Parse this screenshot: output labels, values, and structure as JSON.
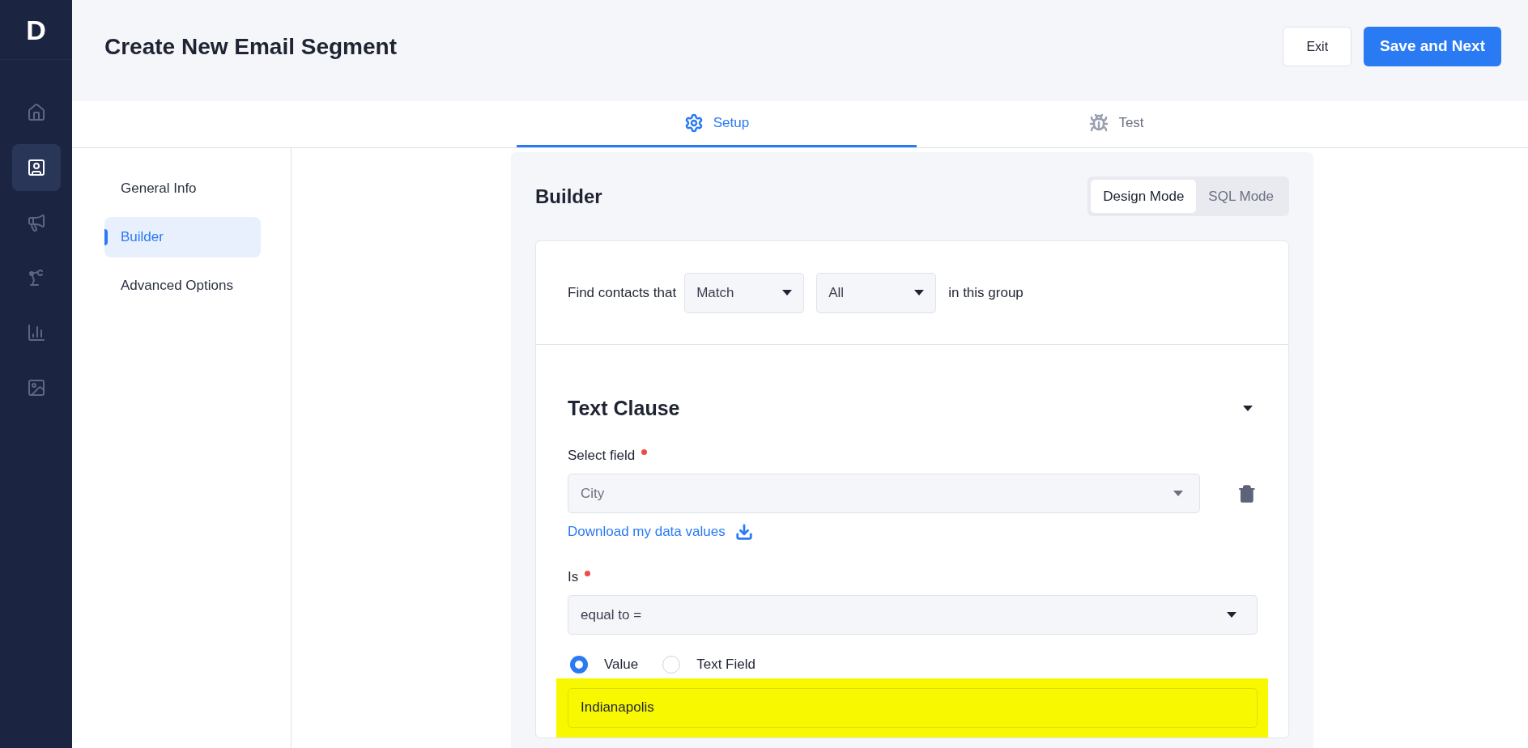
{
  "app_logo": "D",
  "nav": [
    {
      "kind": "home",
      "selected": false
    },
    {
      "kind": "contact",
      "selected": true
    },
    {
      "kind": "megaphone",
      "selected": false
    },
    {
      "kind": "robot-arm",
      "selected": false
    },
    {
      "kind": "chart",
      "selected": false
    },
    {
      "kind": "image",
      "selected": false
    }
  ],
  "header": {
    "title": "Create New Email Segment",
    "buttons": [
      {
        "label": "Exit",
        "kind": "secondary"
      },
      {
        "label": "Save and Next",
        "kind": "primary"
      }
    ]
  },
  "tabs": [
    {
      "label": "Setup",
      "kind": "gear",
      "selected": true
    },
    {
      "label": "Test",
      "kind": "bug",
      "selected": false
    }
  ],
  "steps": [
    {
      "label": "General Info",
      "selected": false
    },
    {
      "label": "Builder",
      "selected": true
    },
    {
      "label": "Advanced Options",
      "selected": false
    }
  ],
  "builder": {
    "title": "Builder",
    "modes": [
      {
        "label": "Design Mode",
        "selected": true
      },
      {
        "label": "SQL Mode",
        "selected": false
      }
    ],
    "match_row": {
      "prefix": "Find contacts that",
      "selects": [
        "Match",
        "All"
      ],
      "suffix": "in this group"
    },
    "clause": {
      "title": "Text Clause",
      "expanded": true,
      "select_field": {
        "label": "Select field",
        "required": true,
        "value": "City",
        "disabled": true
      },
      "download_link": "Download my data values",
      "operator": {
        "label": "Is",
        "required": true,
        "value": "equal to ="
      },
      "source_options": [
        {
          "label": "Value",
          "selected": true
        },
        {
          "label": "Text Field",
          "selected": false
        }
      ],
      "value_input": {
        "value": "Indianapolis",
        "highlighted": true
      }
    }
  }
}
